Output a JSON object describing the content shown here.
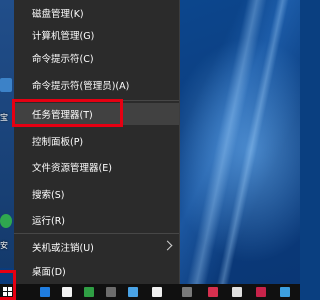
{
  "context_menu": {
    "items": [
      {
        "label": "磁盘管理(K)"
      },
      {
        "label": "计算机管理(G)"
      },
      {
        "label": "命令提示符(C)"
      },
      {
        "label": "命令提示符(管理员)(A)"
      },
      {
        "label": "任务管理器(T)",
        "state": "highlighted"
      },
      {
        "label": "控制面板(P)"
      },
      {
        "label": "文件资源管理器(E)"
      },
      {
        "label": "搜索(S)"
      },
      {
        "label": "运行(R)"
      },
      {
        "label": "关机或注销(U)",
        "has_submenu": true
      },
      {
        "label": "桌面(D)"
      }
    ]
  },
  "desktop": {
    "icon_captions": [
      "宝",
      "安"
    ]
  },
  "colors": {
    "menu_background": "#2b2b2b",
    "menu_hover": "#414141",
    "annotation_red": "#e60012",
    "taskbar": "#101010"
  },
  "taskbar": {
    "icons": [
      "start-windows-icon",
      "app-icon",
      "app-icon",
      "app-icon",
      "app-icon",
      "app-icon",
      "app-icon",
      "app-icon",
      "app-icon",
      "app-icon",
      "app-icon"
    ]
  }
}
